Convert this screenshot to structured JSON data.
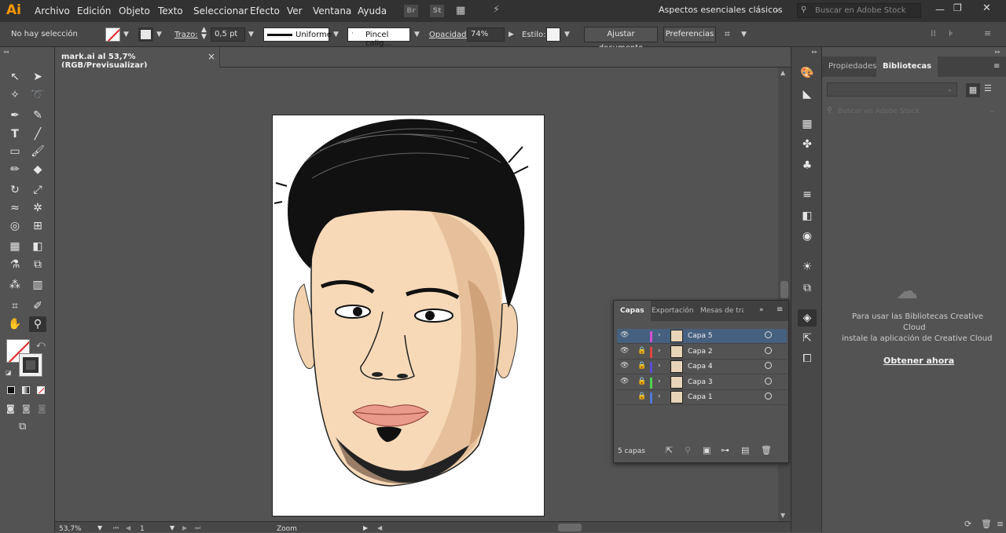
{
  "app": {
    "logo": "Ai"
  },
  "menu": [
    "Archivo",
    "Edición",
    "Objeto",
    "Texto",
    "Seleccionar",
    "Efecto",
    "Ver",
    "Ventana",
    "Ayuda"
  ],
  "menubar_extra": {
    "br": "Br",
    "st": "St"
  },
  "workspace": "Aspectos esenciales clásicos",
  "search_stock_placeholder": "Buscar en Adobe Stock",
  "control": {
    "selection_status": "No hay selección",
    "stroke_label": "Trazo:",
    "stroke_value": "0,5 pt",
    "stroke_profile": "Uniforme",
    "brush": "Pincel calig...",
    "opacity_label": "Opacidad:",
    "opacity_value": "74%",
    "style_label": "Estilo:",
    "adjust_doc": "Ajustar documento",
    "preferences": "Preferencias"
  },
  "document": {
    "tab_title": "mark.ai al 53,7% (RGB/Previsualizar)",
    "close": "×"
  },
  "status": {
    "zoom": "53,7%",
    "artboard_num": "1",
    "tool": "Zoom"
  },
  "right_panel": {
    "tabs": [
      "Propiedades",
      "Bibliotecas"
    ],
    "search_placeholder": "Buscar en Adobe Stock",
    "message_line1": "Para usar las Bibliotecas Creative",
    "message_line2": "Cloud",
    "message_line3": "instale la aplicación de Creative Cloud",
    "get_now": "Obtener ahora"
  },
  "layers_panel": {
    "tabs": [
      "Capas",
      "Exportación",
      "Mesas de tra"
    ],
    "layers": [
      {
        "name": "Capa 5",
        "color": "#d24fd2",
        "visible": true,
        "locked": false,
        "selected": true
      },
      {
        "name": "Capa 2",
        "color": "#e04646",
        "visible": true,
        "locked": true,
        "selected": false
      },
      {
        "name": "Capa 4",
        "color": "#5a4fd6",
        "visible": true,
        "locked": true,
        "selected": false
      },
      {
        "name": "Capa 3",
        "color": "#4fd24f",
        "visible": true,
        "locked": true,
        "selected": false
      },
      {
        "name": "Capa 1",
        "color": "#4f7ad6",
        "visible": false,
        "locked": true,
        "selected": false
      }
    ],
    "count": "5 capas"
  },
  "colors": {
    "accent_selected": "#46607f",
    "logo_orange": "#ff9a00"
  }
}
